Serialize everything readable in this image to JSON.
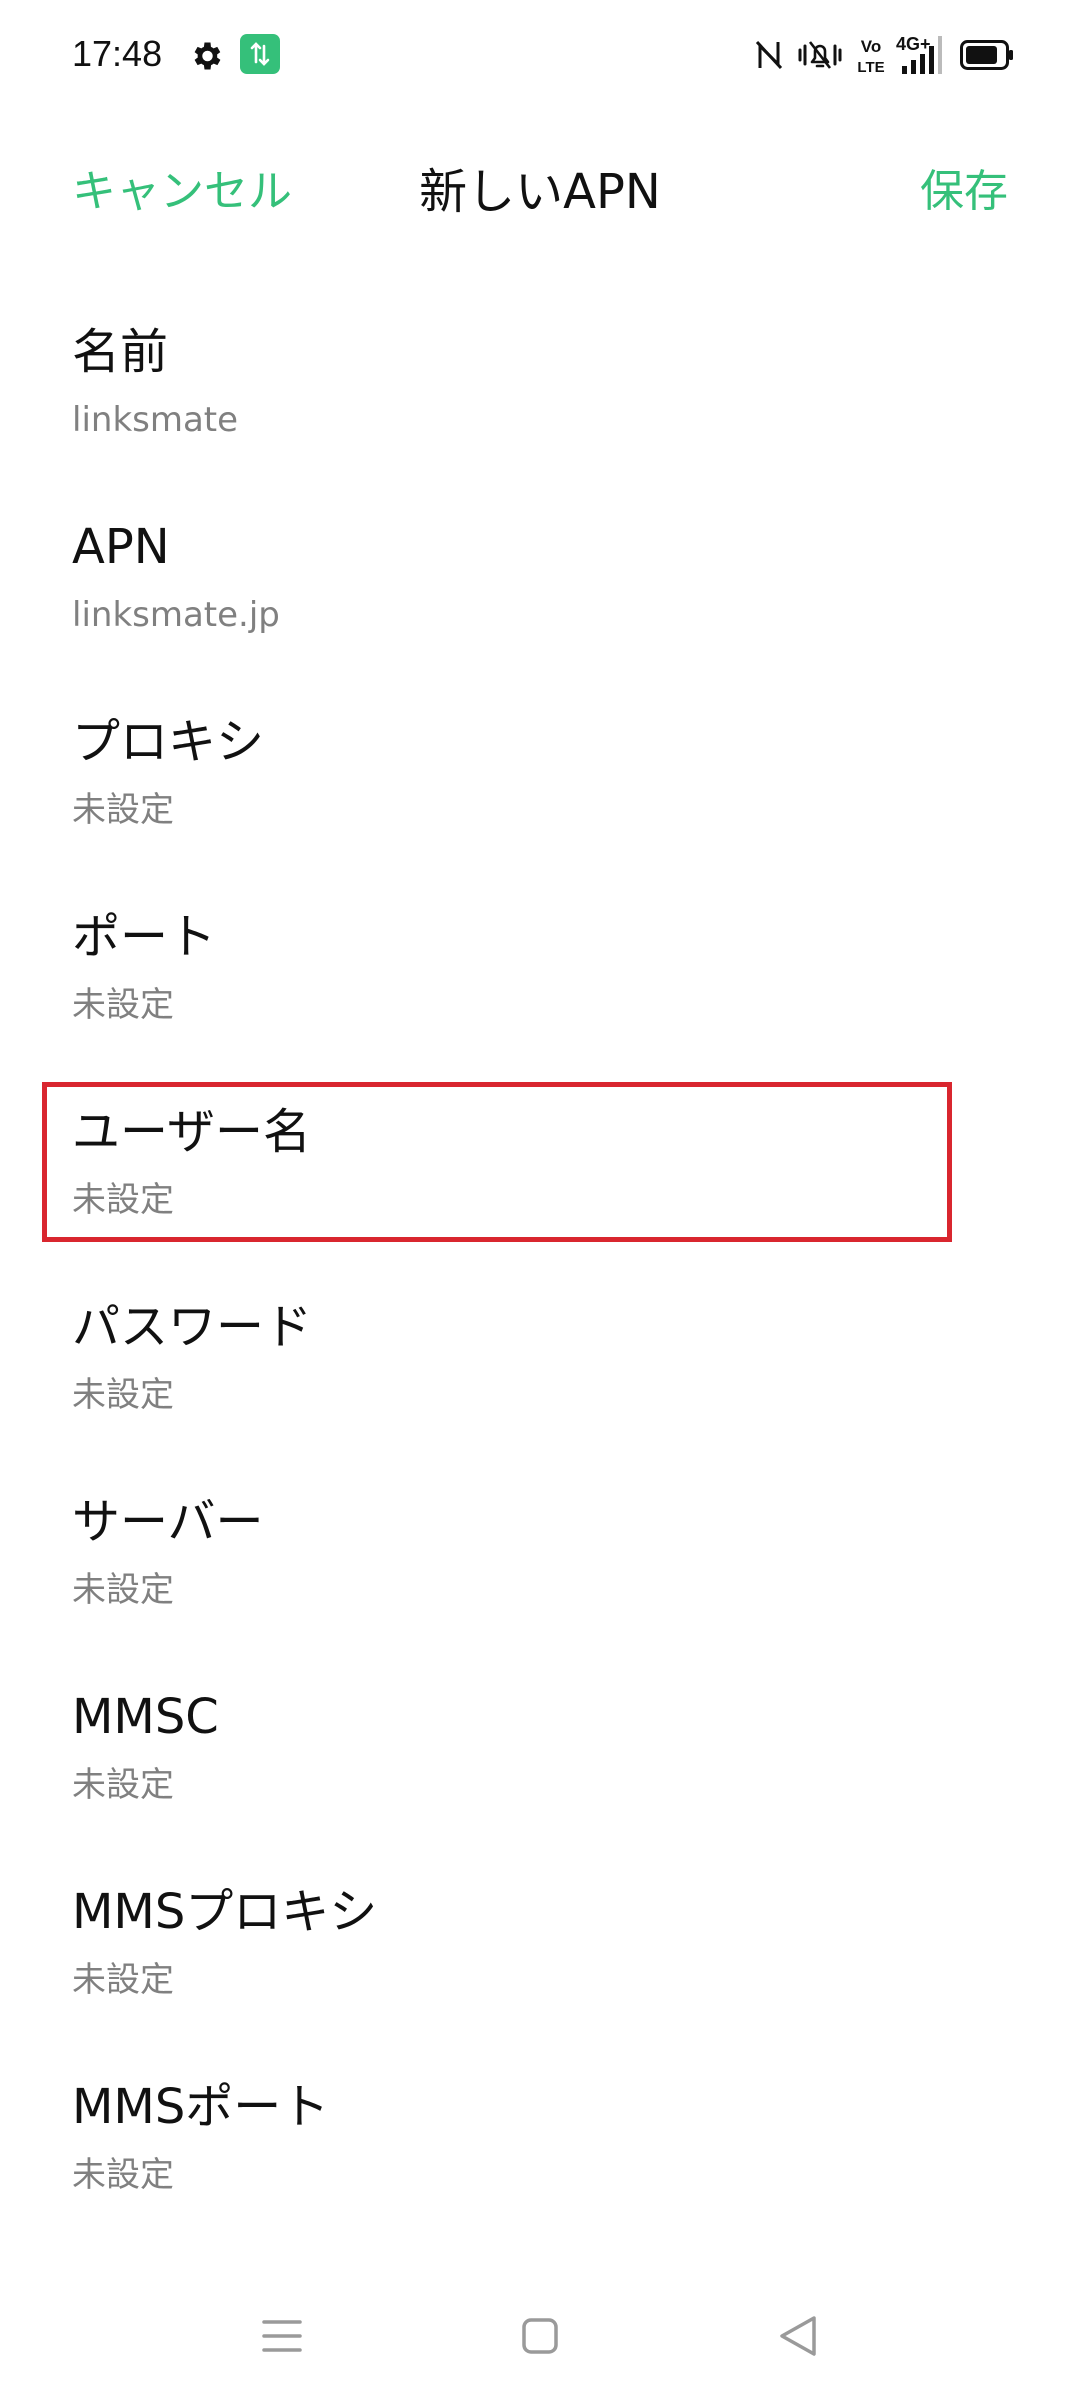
{
  "status_bar": {
    "time": "17:48",
    "icons": [
      "gear-icon",
      "data-transfer-badge-icon",
      "nfc-off-icon",
      "vibrate-mute-icon",
      "volte-icon",
      "signal-4g-icon",
      "battery-icon"
    ],
    "badge_color": "#35c07a"
  },
  "app_bar": {
    "cancel_label": "キャンセル",
    "title": "新しいAPN",
    "save_label": "保存",
    "accent_color": "#35c07a"
  },
  "fields": [
    {
      "label": "名前",
      "value": "linksmate"
    },
    {
      "label": "APN",
      "value": "linksmate.jp"
    },
    {
      "label": "プロキシ",
      "value": "未設定"
    },
    {
      "label": "ポート",
      "value": "未設定"
    },
    {
      "label": "ユーザー名",
      "value": "未設定"
    },
    {
      "label": "パスワード",
      "value": "未設定"
    },
    {
      "label": "サーバー",
      "value": "未設定"
    },
    {
      "label": "MMSC",
      "value": "未設定"
    },
    {
      "label": "MMSプロキシ",
      "value": "未設定"
    },
    {
      "label": "MMSポート",
      "value": "未設定"
    }
  ],
  "highlight": {
    "target": "ユーザー名",
    "color": "#d9262f"
  },
  "nav_bar": {
    "buttons": [
      "menu-icon",
      "home-icon",
      "back-icon"
    ]
  }
}
